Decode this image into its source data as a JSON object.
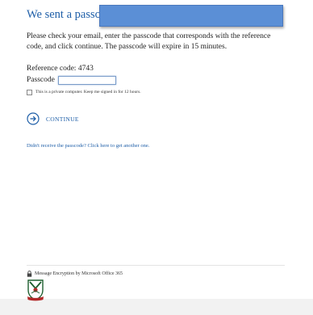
{
  "header": {
    "title": "We sent a passcode"
  },
  "body": {
    "instructions": "Please check your email, enter the passcode that corresponds with the reference code, and click continue. The passcode will expire in 15 minutes.",
    "reference_code": "Reference code: 4743",
    "passcode_label": "Passcode",
    "passcode_value": "",
    "private_computer_label": "This is a private computer. Keep me signed in for 12 hours.",
    "continue_label": "CONTINUE",
    "resend_link": "Didn't receive the passcode? Click here to get another one."
  },
  "footer": {
    "encryption_text": "Message Encryption by Microsoft Office 365",
    "icons": [
      "lock-icon",
      "crest-logo"
    ]
  },
  "colors": {
    "link": "#1f5fa8",
    "redaction": "#5b8fd6"
  }
}
